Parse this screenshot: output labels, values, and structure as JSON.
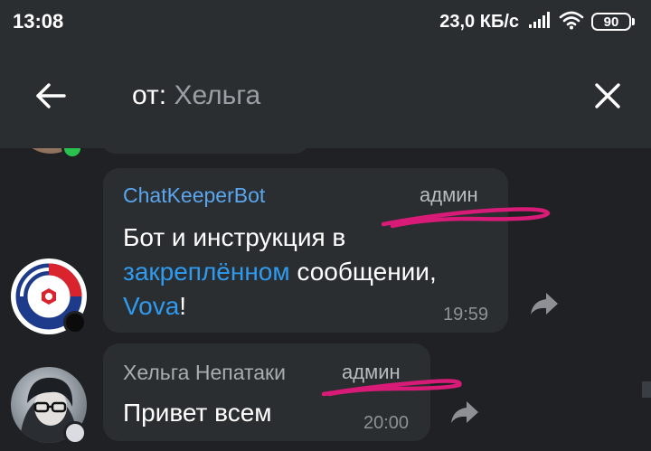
{
  "status_bar": {
    "time": "13:08",
    "network_speed": "23,0 КБ/с",
    "battery_level": "90",
    "icons": [
      "signal-icon",
      "wifi-icon",
      "battery-icon"
    ]
  },
  "app_bar": {
    "search_prefix": "от: ",
    "search_name": "Хельга",
    "back_icon": "arrow-left-icon",
    "close_icon": "close-icon"
  },
  "messages": [
    {
      "sender": "ChatKeeperBot",
      "sender_color": "#5aa6ee",
      "role": "админ",
      "text_part1": "Бот и инструкция в",
      "link": "закреплённом",
      "text_part2": " сообщении,",
      "mention": "Vova",
      "text_part3": "!",
      "time": "19:59",
      "status": "online-dark"
    },
    {
      "sender": "Хельга Непатаки",
      "sender_color": "#a9adb2",
      "role": "админ",
      "text": "Привет всем",
      "time": "20:00",
      "status": "offline"
    }
  ],
  "colors": {
    "bar_background": "#2b2e31",
    "chat_background": "#1f2124",
    "bubble_background": "#2b2e31",
    "link": "#2e9bf0",
    "annotation_underline": "#d81b77",
    "online": "#29c24f"
  }
}
